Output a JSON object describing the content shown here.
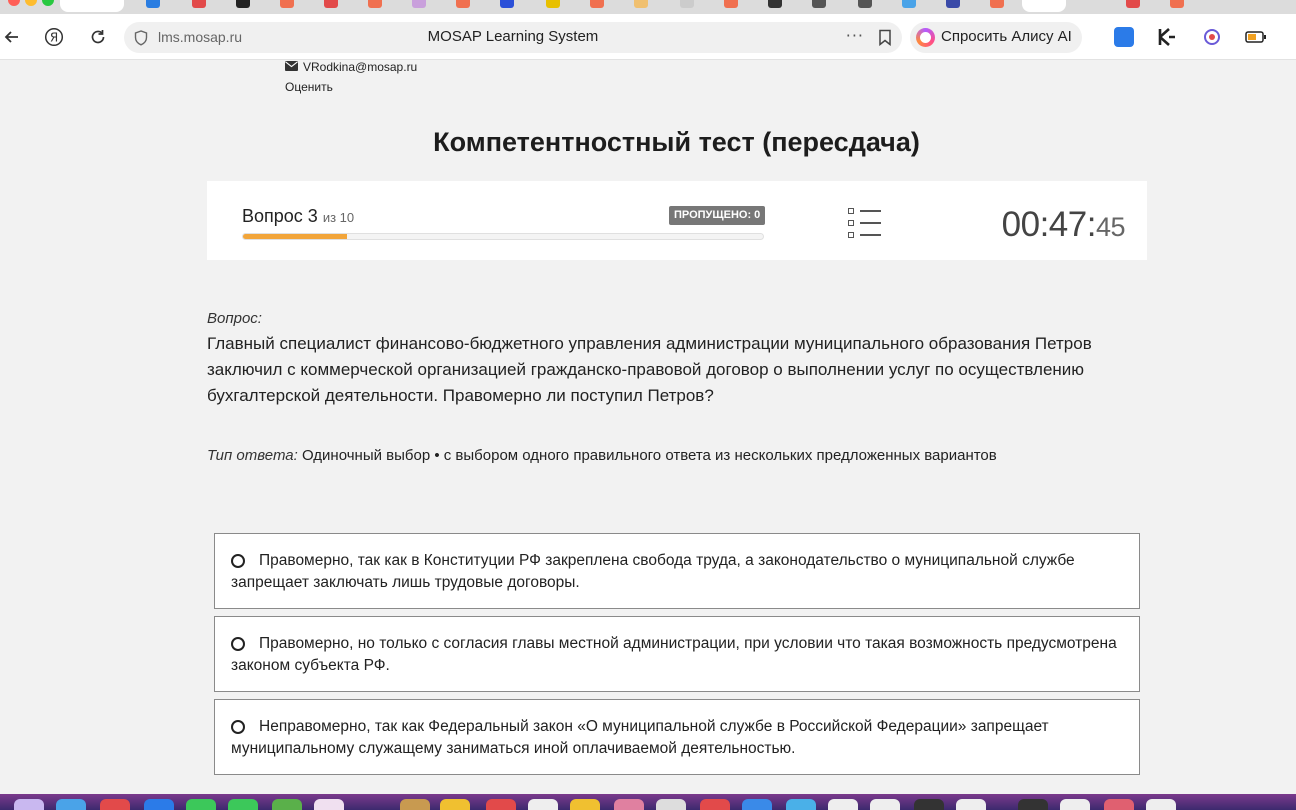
{
  "browser": {
    "url": "lms.mosap.ru",
    "page_title": "MOSAP Learning System",
    "alice_label": "Спросить Алису AI",
    "more_icon": "ellipsis-icon",
    "bookmark_icon": "bookmark-icon",
    "back_icon": "back-arrow-icon",
    "reload_icon": "reload-icon",
    "yandex_icon": "yandex-icon",
    "site_info_icon": "shield-icon"
  },
  "user": {
    "email": "VRodkina@mosap.ru",
    "rate_link": "Оценить"
  },
  "test": {
    "title": "Компетентностный тест (пересдача)",
    "question_word": "Вопрос 3",
    "question_of": "из 10",
    "current": 3,
    "total": 10,
    "progress_fraction": 0.2,
    "skipped_label": "ПРОПУЩЕНО: 0",
    "timer_main": "00:47:",
    "timer_seconds": "45"
  },
  "question": {
    "label": "Вопрос:",
    "text": "Главный специалист финансово-бюджетного управления администрации муниципального образования Петров заключил с коммерческой организацией гражданско-правовой договор о выполнении услуг по осуществлению бухгалтерской деятельности. Правомерно ли поступил Петров?",
    "answer_type_label": "Тип ответа:",
    "answer_type_value": "Одиночный выбор • с выбором одного правильного ответа из нескольких предложенных вариантов"
  },
  "options": [
    {
      "text": "Правомерно, так как в Конституции РФ закреплена свобода труда, а законодательство о муниципальной службе запрещает заключать лишь трудовые договоры."
    },
    {
      "text": "Правомерно, но только с согласия главы местной администрации, при условии что такая возможность предусмотрена законом субъекта РФ."
    },
    {
      "text": "Неправомерно, так как Федеральный закон «О муниципальной службе в Российской Федерации» запрещает муниципальному служащему заниматься иной оплачиваемой деятельностью."
    }
  ],
  "colors": {
    "progress": "#f2a53a",
    "skipped_badge": "#777777",
    "page_bg": "#f2f2f2"
  }
}
